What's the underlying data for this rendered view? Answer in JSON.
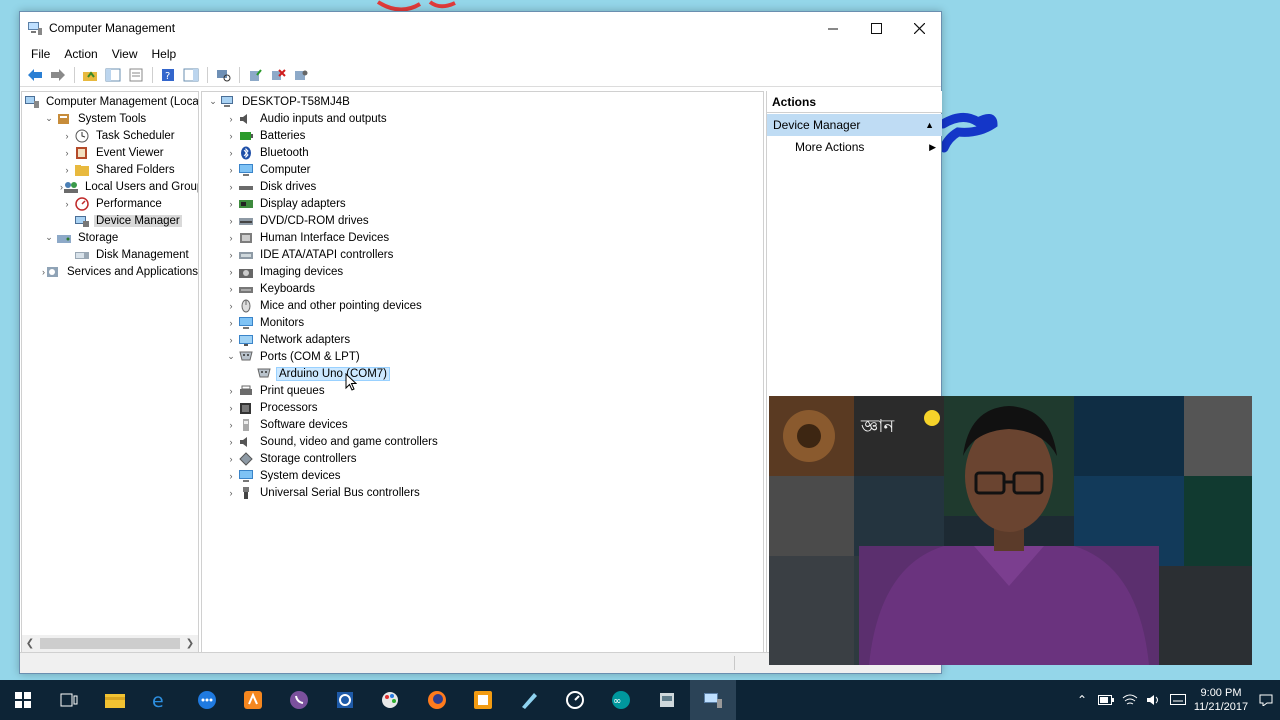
{
  "window": {
    "title": "Computer Management"
  },
  "menu": [
    "File",
    "Action",
    "View",
    "Help"
  ],
  "left_tree": [
    {
      "label": "Computer Management (Local",
      "level": 0,
      "exp": "",
      "icon": "computer-management-icon",
      "selected": false
    },
    {
      "label": "System Tools",
      "level": 1,
      "exp": "down",
      "icon": "system-tools-icon",
      "selected": false
    },
    {
      "label": "Task Scheduler",
      "level": 2,
      "exp": "right",
      "icon": "clock-icon",
      "selected": false
    },
    {
      "label": "Event Viewer",
      "level": 2,
      "exp": "right",
      "icon": "event-viewer-icon",
      "selected": false
    },
    {
      "label": "Shared Folders",
      "level": 2,
      "exp": "right",
      "icon": "folder-icon",
      "selected": false
    },
    {
      "label": "Local Users and Groups",
      "level": 2,
      "exp": "right",
      "icon": "users-icon",
      "selected": false
    },
    {
      "label": "Performance",
      "level": 2,
      "exp": "right",
      "icon": "performance-icon",
      "selected": false
    },
    {
      "label": "Device Manager",
      "level": 2,
      "exp": "",
      "icon": "device-manager-icon",
      "selected": true
    },
    {
      "label": "Storage",
      "level": 1,
      "exp": "down",
      "icon": "storage-icon",
      "selected": false
    },
    {
      "label": "Disk Management",
      "level": 2,
      "exp": "",
      "icon": "disk-icon",
      "selected": false
    },
    {
      "label": "Services and Applications",
      "level": 1,
      "exp": "right",
      "icon": "services-icon",
      "selected": false
    }
  ],
  "device_tree": {
    "root": "DESKTOP-T58MJ4B",
    "items": [
      {
        "label": "Audio inputs and outputs",
        "icon": "speaker-icon",
        "exp": "right",
        "level": 1
      },
      {
        "label": "Batteries",
        "icon": "battery-icon",
        "exp": "right",
        "level": 1
      },
      {
        "label": "Bluetooth",
        "icon": "bluetooth-icon",
        "exp": "right",
        "level": 1
      },
      {
        "label": "Computer",
        "icon": "monitor-icon",
        "exp": "right",
        "level": 1
      },
      {
        "label": "Disk drives",
        "icon": "disk-drive-icon",
        "exp": "right",
        "level": 1
      },
      {
        "label": "Display adapters",
        "icon": "display-adapter-icon",
        "exp": "right",
        "level": 1
      },
      {
        "label": "DVD/CD-ROM drives",
        "icon": "dvd-icon",
        "exp": "right",
        "level": 1
      },
      {
        "label": "Human Interface Devices",
        "icon": "hid-icon",
        "exp": "right",
        "level": 1
      },
      {
        "label": "IDE ATA/ATAPI controllers",
        "icon": "ide-icon",
        "exp": "right",
        "level": 1
      },
      {
        "label": "Imaging devices",
        "icon": "camera-icon",
        "exp": "right",
        "level": 1
      },
      {
        "label": "Keyboards",
        "icon": "keyboard-icon",
        "exp": "right",
        "level": 1
      },
      {
        "label": "Mice and other pointing devices",
        "icon": "mouse-icon",
        "exp": "right",
        "level": 1
      },
      {
        "label": "Monitors",
        "icon": "monitor-icon",
        "exp": "right",
        "level": 1
      },
      {
        "label": "Network adapters",
        "icon": "network-icon",
        "exp": "right",
        "level": 1
      },
      {
        "label": "Ports (COM & LPT)",
        "icon": "port-icon",
        "exp": "down",
        "level": 1
      },
      {
        "label": "Arduino Uno (COM7)",
        "icon": "port-icon",
        "exp": "",
        "level": 2,
        "selected": true
      },
      {
        "label": "Print queues",
        "icon": "printer-icon",
        "exp": "right",
        "level": 1
      },
      {
        "label": "Processors",
        "icon": "processor-icon",
        "exp": "right",
        "level": 1
      },
      {
        "label": "Software devices",
        "icon": "software-device-icon",
        "exp": "right",
        "level": 1
      },
      {
        "label": "Sound, video and game controllers",
        "icon": "speaker-icon",
        "exp": "right",
        "level": 1
      },
      {
        "label": "Storage controllers",
        "icon": "storage-controller-icon",
        "exp": "right",
        "level": 1
      },
      {
        "label": "System devices",
        "icon": "monitor-icon",
        "exp": "right",
        "level": 1
      },
      {
        "label": "Universal Serial Bus controllers",
        "icon": "usb-icon",
        "exp": "right",
        "level": 1
      }
    ]
  },
  "actions": {
    "header": "Actions",
    "section": "Device Manager",
    "items": [
      "More Actions"
    ]
  },
  "clock": {
    "time": "9:00 PM",
    "date": "11/21/2017"
  },
  "colors": {
    "taskbar": "#0d2436",
    "selection": "#cce8ff",
    "actions_section": "#bfdcf4"
  }
}
